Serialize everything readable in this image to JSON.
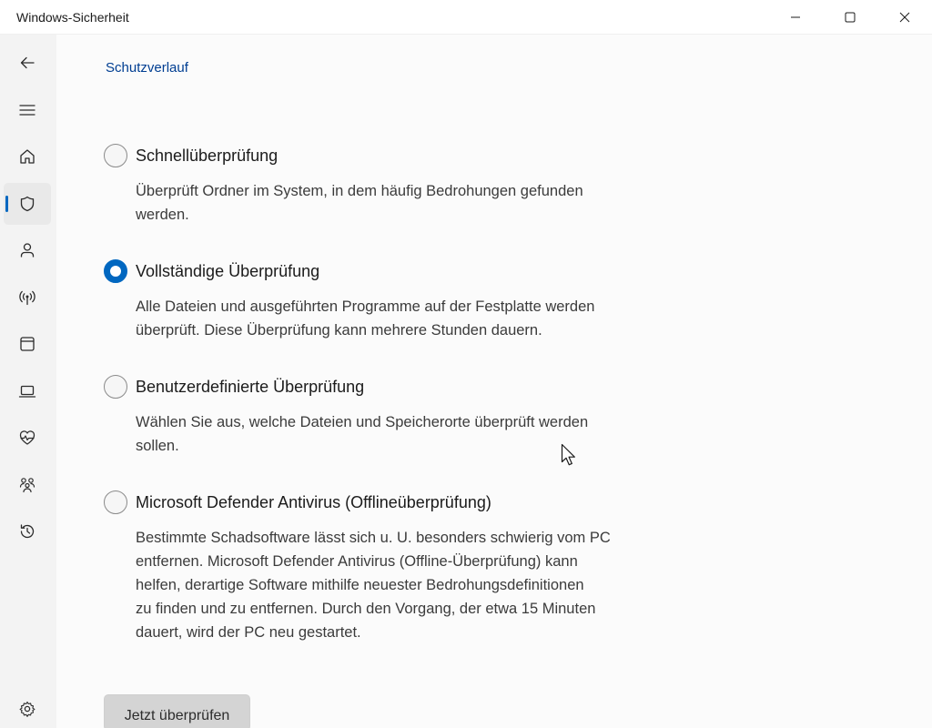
{
  "window": {
    "title": "Windows-Sicherheit",
    "controls": [
      "minimize",
      "maximize",
      "close"
    ]
  },
  "sidebar": {
    "items": [
      {
        "name": "back",
        "icon": "back-arrow-icon"
      },
      {
        "name": "menu",
        "icon": "hamburger-menu-icon"
      },
      {
        "name": "home",
        "icon": "home-icon"
      },
      {
        "name": "virus-protection",
        "icon": "shield-icon",
        "active": true
      },
      {
        "name": "account-protection",
        "icon": "person-icon"
      },
      {
        "name": "firewall-network",
        "icon": "wireless-signal-icon"
      },
      {
        "name": "app-browser-control",
        "icon": "browser-window-icon"
      },
      {
        "name": "device-security",
        "icon": "laptop-icon"
      },
      {
        "name": "device-performance",
        "icon": "heart-pulse-icon"
      },
      {
        "name": "family-options",
        "icon": "family-icon"
      },
      {
        "name": "protection-history",
        "icon": "history-icon"
      },
      {
        "name": "settings",
        "icon": "gear-icon"
      }
    ],
    "accent_color": "#0067c0"
  },
  "main": {
    "protection_history_link": "Schutzverlauf",
    "scan_options": [
      {
        "label": "Schnellüberprüfung",
        "description_lines": [
          "Überprüft Ordner im System, in dem häufig Bedrohungen gefunden",
          "werden."
        ],
        "selected": false
      },
      {
        "label": "Vollständige Überprüfung",
        "description_lines": [
          "Alle Dateien und ausgeführten Programme auf der Festplatte werden",
          "überprüft. Diese Überprüfung kann mehrere Stunden dauern."
        ],
        "selected": true
      },
      {
        "label": "Benutzerdefinierte Überprüfung",
        "description_lines": [
          "Wählen Sie aus, welche Dateien und Speicherorte überprüft werden",
          "sollen."
        ],
        "selected": false
      },
      {
        "label": "Microsoft Defender Antivirus (Offlineüberprüfung)",
        "description_lines": [
          "Bestimmte Schadsoftware lässt sich u. U. besonders schwierig vom PC",
          "entfernen. Microsoft Defender Antivirus (Offline-Überprüfung) kann",
          "helfen, derartige Software mithilfe neuester Bedrohungsdefinitionen",
          "zu finden und zu entfernen. Durch den Vorgang, der etwa 15 Minuten",
          "dauert, wird der PC neu gestartet."
        ],
        "selected": false
      }
    ],
    "scan_now_button": "Jetzt überprüfen"
  }
}
